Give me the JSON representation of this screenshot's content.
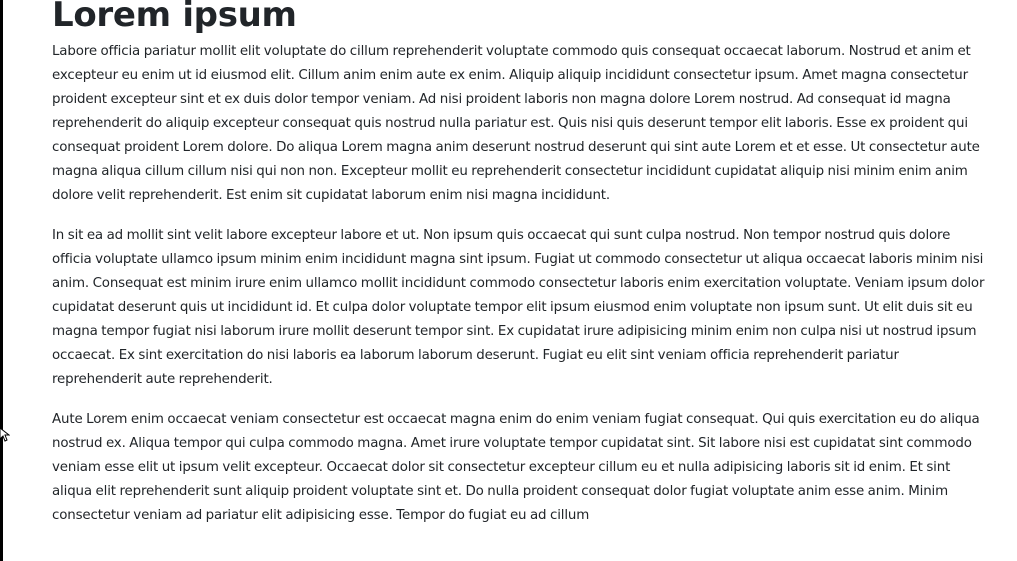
{
  "page": {
    "title": "Lorem ipsum",
    "paragraphs": [
      "Labore officia pariatur mollit elit voluptate do cillum reprehenderit voluptate commodo quis consequat occaecat laborum. Nostrud et anim et excepteur eu enim ut id eiusmod elit. Cillum anim enim aute ex enim. Aliquip aliquip incididunt consectetur ipsum. Amet magna consectetur proident excepteur sint et ex duis dolor tempor veniam. Ad nisi proident laboris non magna dolore Lorem nostrud. Ad consequat id magna reprehenderit do aliquip excepteur consequat quis nostrud nulla pariatur est. Quis nisi quis deserunt tempor elit laboris. Esse ex proident qui consequat proident Lorem dolore. Do aliqua Lorem magna anim deserunt nostrud deserunt qui sint aute Lorem et et esse. Ut consectetur aute magna aliqua cillum cillum nisi qui non non. Excepteur mollit eu reprehenderit consectetur incididunt cupidatat aliquip nisi minim enim anim dolore velit reprehenderit. Est enim sit cupidatat laborum enim nisi magna incididunt.",
      "In sit ea ad mollit sint velit labore excepteur labore et ut. Non ipsum quis occaecat qui sunt culpa nostrud. Non tempor nostrud quis dolore officia voluptate ullamco ipsum minim enim incididunt magna sint ipsum. Fugiat ut commodo consectetur ut aliqua occaecat laboris minim nisi anim. Consequat est minim irure enim ullamco mollit incididunt commodo consectetur laboris enim exercitation voluptate. Veniam ipsum dolor cupidatat deserunt quis ut incididunt id. Et culpa dolor voluptate tempor elit ipsum eiusmod enim voluptate non ipsum sunt. Ut elit duis sit eu magna tempor fugiat nisi laborum irure mollit deserunt tempor sint. Ex cupidatat irure adipisicing minim enim non culpa nisi ut nostrud ipsum occaecat. Ex sint exercitation do nisi laboris ea laborum laborum deserunt. Fugiat eu elit sint veniam officia reprehenderit pariatur reprehenderit aute reprehenderit.",
      "Aute Lorem enim occaecat veniam consectetur est occaecat magna enim do enim veniam fugiat consequat. Qui quis exercitation eu do aliqua nostrud ex. Aliqua tempor qui culpa commodo magna. Amet irure voluptate tempor cupidatat sint. Sit labore nisi est cupidatat sint commodo veniam esse elit ut ipsum velit excepteur. Occaecat dolor sit consectetur excepteur cillum eu et nulla adipisicing laboris sit id enim. Et sint aliqua elit reprehenderit sunt aliquip proident voluptate sint et. Do nulla proident consequat dolor fugiat voluptate anim esse anim. Minim consectetur veniam ad pariatur elit adipisicing esse. Tempor do fugiat eu ad cillum"
    ]
  },
  "colors": {
    "text": "#212529",
    "background": "#ffffff",
    "window_edge": "#000000"
  },
  "icons": {
    "cursor": "mouse-pointer-icon"
  }
}
